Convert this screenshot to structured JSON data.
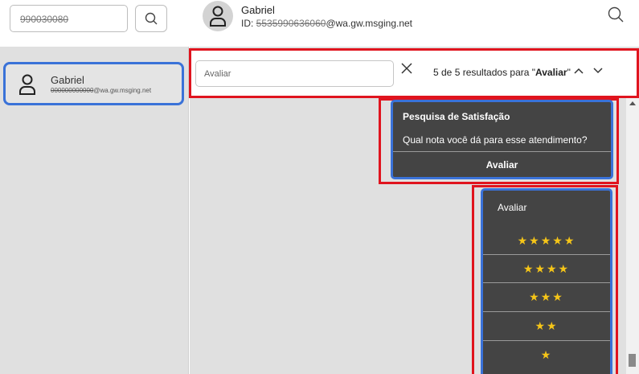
{
  "sidebar": {
    "search_value": "990030080",
    "contact": {
      "name": "Gabriel",
      "id_redacted": "000000000000",
      "id_suffix": "@wa.gw.msging.net"
    }
  },
  "header": {
    "name": "Gabriel",
    "id_prefix": "ID: ",
    "id_redacted": "5535990636060",
    "id_suffix": "@wa.gw.msging.net"
  },
  "search": {
    "value": "Avaliar",
    "results_prefix": "5 de 5 resultados para \"",
    "term": "Avaliar",
    "results_suffix": "\""
  },
  "survey": {
    "title": "Pesquisa de Satisfação",
    "question": "Qual nota você dá para esse atendimento?",
    "button": "Avaliar"
  },
  "rating": {
    "label": "Avaliar",
    "options": [
      "★★★★★",
      "★★★★",
      "★★★",
      "★★",
      "★"
    ]
  },
  "colors": {
    "highlight_red": "#e0141e",
    "selection_blue": "#3a72d8",
    "card_dark": "#444444",
    "star": "#f5c518"
  }
}
